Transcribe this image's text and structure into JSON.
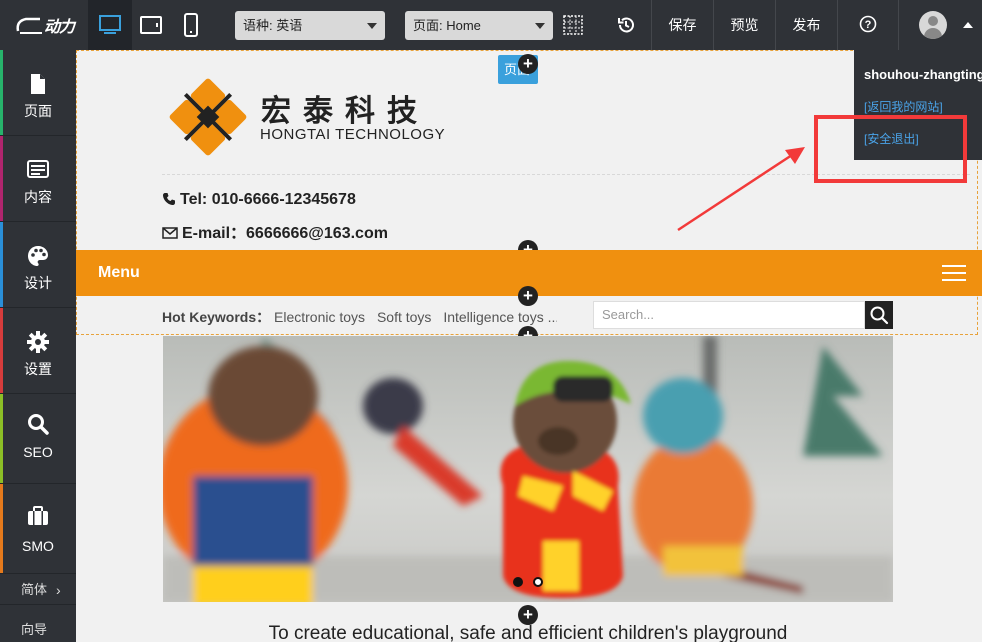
{
  "topbar": {
    "logo_text": "动力",
    "language_select": "语种:  英语",
    "page_select": "页面:  Home",
    "save_label": "保存",
    "preview_label": "预览",
    "publish_label": "发布",
    "help_icon": "?"
  },
  "sidebar": {
    "items": [
      {
        "label": "页面",
        "color": "#27b36b"
      },
      {
        "label": "内容",
        "color": "#b0256d"
      },
      {
        "label": "设计",
        "color": "#2a8fd8"
      },
      {
        "label": "设置",
        "color": "#d63c3c"
      },
      {
        "label": "SEO",
        "color": "#8cbf26"
      },
      {
        "label": "SMO",
        "color": "#e57a1c"
      }
    ],
    "lang_label": "简体",
    "guide_label": "向导"
  },
  "canvas": {
    "page_tag": "页面",
    "company_cn": "宏泰科技",
    "company_en": "HONGTAI TECHNOLOGY",
    "tel_label": "Tel: 010-6666-12345678",
    "email_label": "E-mail：6666666@163.com",
    "menu_label": "Menu",
    "hot_keywords_label": "Hot Keywords：",
    "hot_keywords": [
      "Electronic toys",
      "Soft toys",
      "Intelligence toys ..."
    ],
    "search_placeholder": "Search...",
    "slogan": "To create educational, safe and efficient children's playground",
    "accent_color": "#f0900f"
  },
  "user_menu": {
    "username": "shouhou-zhangting",
    "back_link": "[返回我的网站]",
    "logout_link": "[安全退出]"
  }
}
